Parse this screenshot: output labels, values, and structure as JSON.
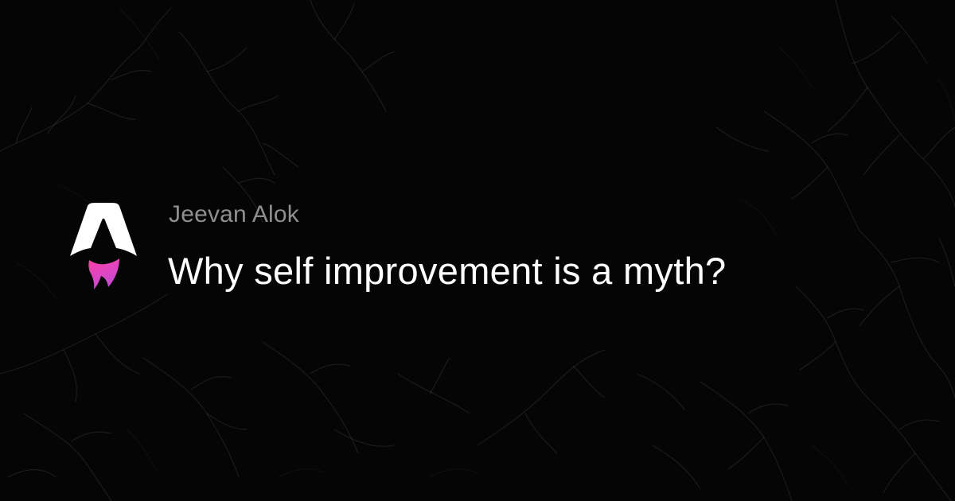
{
  "card": {
    "author": "Jeevan Alok",
    "title": "Why self improvement is a myth?"
  },
  "logo": {
    "icon": "astro-logo-icon",
    "colors": {
      "body": "#ffffff",
      "flame_top": "#ff3ea5",
      "flame_bottom": "#c54bd6"
    }
  },
  "background": {
    "color": "#050505",
    "pattern": "faint-gray-branching-lines"
  }
}
